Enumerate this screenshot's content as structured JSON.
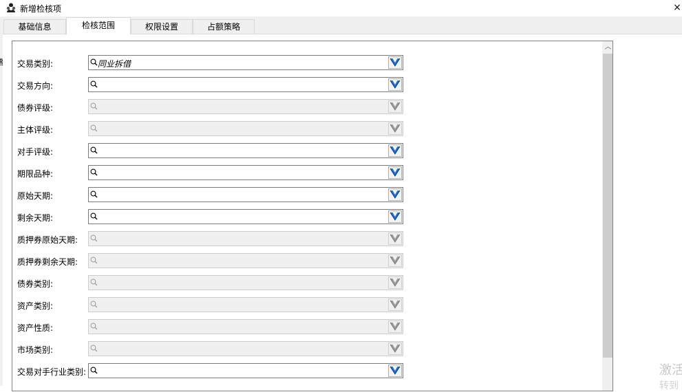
{
  "window": {
    "title": "新增检核项",
    "close_glyph": "×"
  },
  "left_sliver": {
    "mark": "客"
  },
  "tabs": [
    {
      "label": "基础信息",
      "active": false
    },
    {
      "label": "检核范围",
      "active": true
    },
    {
      "label": "权限设置",
      "active": false
    },
    {
      "label": "占额策略",
      "active": false
    }
  ],
  "fields": [
    {
      "label": "交易类别:",
      "value": "同业拆借",
      "enabled": true
    },
    {
      "label": "交易方向:",
      "value": "",
      "enabled": true
    },
    {
      "label": "债券评级:",
      "value": "",
      "enabled": false
    },
    {
      "label": "主体评级:",
      "value": "",
      "enabled": false
    },
    {
      "label": "对手评级:",
      "value": "",
      "enabled": true
    },
    {
      "label": "期限品种:",
      "value": "",
      "enabled": true
    },
    {
      "label": "原始天期:",
      "value": "",
      "enabled": true
    },
    {
      "label": "剩余天期:",
      "value": "",
      "enabled": true
    },
    {
      "label": "质押券原始天期:",
      "value": "",
      "enabled": false
    },
    {
      "label": "质押券剩余天期:",
      "value": "",
      "enabled": false
    },
    {
      "label": "债券类别:",
      "value": "",
      "enabled": false
    },
    {
      "label": "资产类别:",
      "value": "",
      "enabled": false
    },
    {
      "label": "资产性质:",
      "value": "",
      "enabled": false
    },
    {
      "label": "市场类别:",
      "value": "",
      "enabled": false
    },
    {
      "label": "交易对手行业类别:",
      "value": "",
      "enabled": true
    }
  ],
  "scrollbar": {
    "up_glyph": "︿"
  },
  "watermark": {
    "line1": "激活",
    "line2": "转到"
  },
  "colors": {
    "dropdown_enabled": "#1e6fd6",
    "dropdown_disabled": "#9a9a9a"
  },
  "icons": {
    "app": "user-group-icon",
    "search": "search-icon",
    "dropdown": "chevron-down-icon"
  }
}
